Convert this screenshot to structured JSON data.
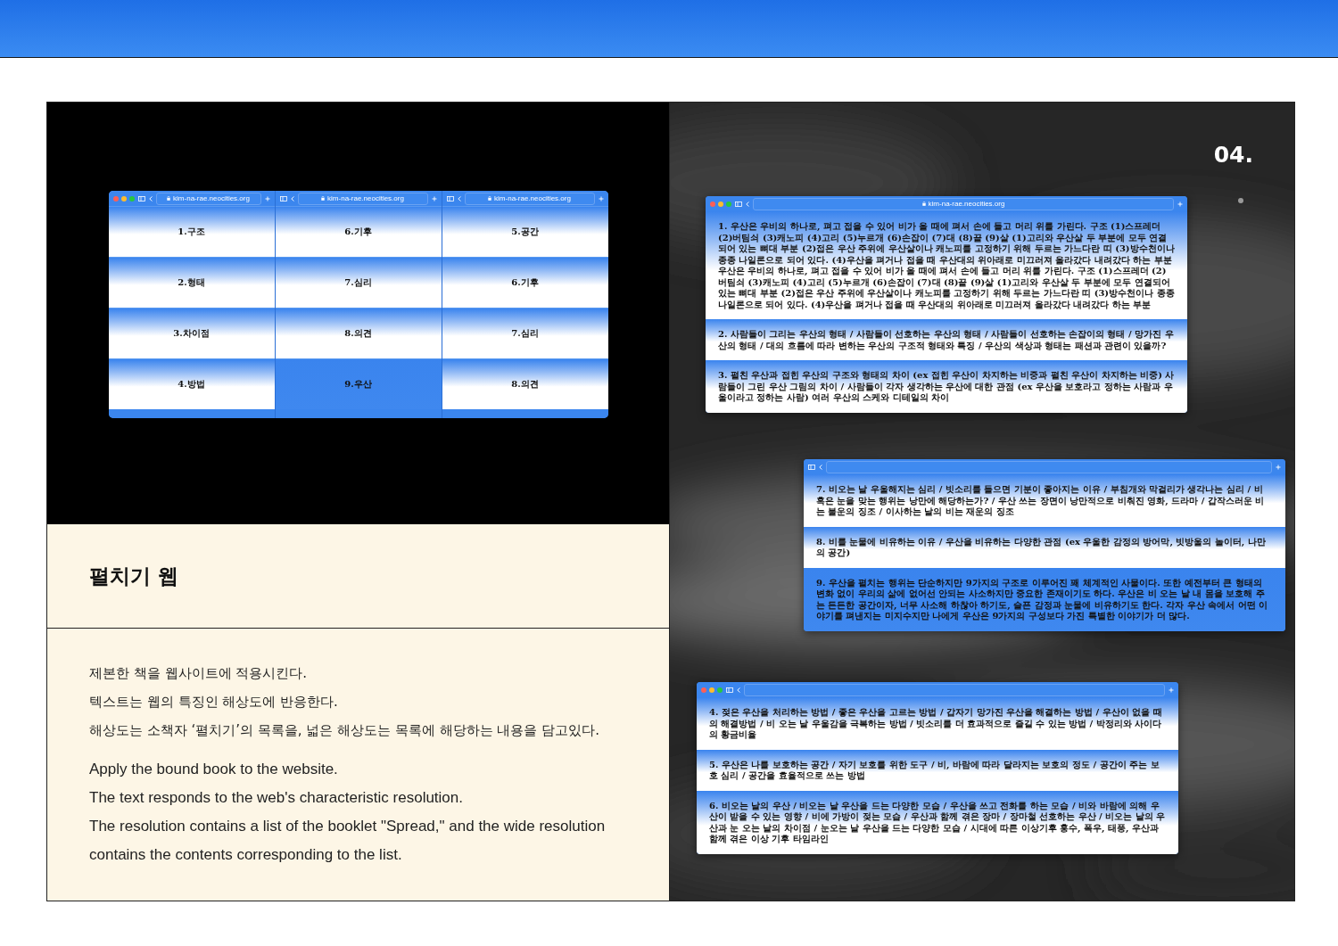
{
  "preview": {
    "windows": [
      {
        "url": "kim-na-rae.neocities.org",
        "traffic_lights": true,
        "items": [
          {
            "label": "1.구조",
            "kind": "fade"
          },
          {
            "label": "2.형태",
            "kind": "fade"
          },
          {
            "label": "3.차이점",
            "kind": "fade"
          },
          {
            "label": "4.방법",
            "kind": "fade"
          }
        ]
      },
      {
        "url": "kim-na-rae.neocities.org",
        "traffic_lights": false,
        "items": [
          {
            "label": "6.기후",
            "kind": "fade"
          },
          {
            "label": "7.심리",
            "kind": "fade"
          },
          {
            "label": "8.의견",
            "kind": "fade"
          },
          {
            "label": "9.우산",
            "kind": "solid"
          }
        ]
      },
      {
        "url": "kim-na-rae.neocities.org",
        "traffic_lights": false,
        "items": [
          {
            "label": "5.공간",
            "kind": "fade"
          },
          {
            "label": "6.기후",
            "kind": "fade"
          },
          {
            "label": "7.심리",
            "kind": "fade"
          },
          {
            "label": "8.의견",
            "kind": "fade"
          }
        ]
      }
    ]
  },
  "project": {
    "title": "펼치기 웹",
    "description_ko": [
      "제본한 책을 웹사이트에 적용시킨다.",
      "텍스트는 웹의 특징인 해상도에 반응한다.",
      "해상도는 소책자 ‘펼치기’의 목록을, 넓은 해상도는 목록에 해당하는 내용을 담고있다."
    ],
    "description_en": [
      "Apply the bound book to the website.",
      "The text responds to the web's characteristic resolution.",
      "The resolution contains a list of the booklet \"Spread,\" and the wide resolution contains the contents corresponding to the list."
    ]
  },
  "showcase": {
    "number": "04.",
    "windows": [
      {
        "url": "kim-na-rae.neocities.org",
        "traffic_lights": true,
        "sections": [
          {
            "kind": "fade",
            "text": "1. 우산은 우비의 하나로, 펴고 접을 수 있어 비가 올 때에 펴서 손에 들고 머리 위를 가린다. 구조 (1)스프레더 (2)버팀쇠 (3)캐노피 (4)고리 (5)누르개 (6)손잡이 (7)대 (8)끝 (9)살 (1)고리와 우산살 두 부분에 모두 연결되어 있는 뼈대 부분 (2)접은 우산 주위에 우산살이나 캐노피를 고정하기 위해 두르는 가느다란 띠 (3)방수천이나 종종 나일론으로 되어 있다. (4)우산을 펴거나 접을 때 우산대의 위아래로 미끄러져 올라갔다 내려갔다 하는 부분 우산은 우비의 하나로, 펴고 접을 수 있어 비가 올 때에 펴서 손에 들고 머리 위를 가린다. 구조 (1)스프레더 (2)버팀쇠 (3)캐노피 (4)고리 (5)누르개 (6)손잡이 (7)대 (8)끝 (9)살 (1)고리와 우산살 두 부분에 모두 연결되어 있는 뼈대 부분 (2)접은 우산 주위에 우산살이나 캐노피를 고정하기 위해 두르는 가느다란 띠 (3)방수천이나 종종 나일론으로 되어 있다. (4)우산을 펴거나 접을 때 우산대의 위아래로 미끄러져 올라갔다 내려갔다 하는 부분"
          },
          {
            "kind": "fade",
            "text": "2. 사람들이 그리는 우산의 형태 / 사람들이 선호하는 우산의 형태 / 사람들이 선호하는 손잡이의 형태 / 망가진 우산의 형태 / 대의 흐름에 따라 변하는 우산의 구조적 형태와 특징 / 우산의 색상과 형태는 패션과 관련이 있을까?"
          },
          {
            "kind": "fade",
            "text": "3. 펼친 우산과 접힌 우산의 구조와 형태의 차이 (ex 접힌 우산이 차지하는 비중과 펼친 우산이 차지하는 비중) 사람들이 그린 우산 그림의 차이 / 사람들이 각자 생각하는 우산에 대한 관점 (ex 우산을 보호라고 정하는 사람과 우울이라고 정하는 사람) 여러 우산의 스케와 디테일의 차이"
          }
        ]
      },
      {
        "traffic_lights": false,
        "sections": [
          {
            "kind": "fade",
            "text": "7. 비오는 날 우울해지는 심리 / 빗소리를 들으면 기분이 좋아지는 이유 / 부침개와 막걸리가 생각나는 심리 / 비 혹은 눈을 맞는 행위는 낭만에 해당하는가? / 우산 쓰는 장면이 낭만적으로 비춰진 영화, 드라마 / 갑작스러운 비는 불운의 징조 / 이사하는 날의 비는 재운의 징조"
          },
          {
            "kind": "fade",
            "text": "8. 비를 눈물에 비유하는 이유 / 우산을 비유하는 다양한 관점 (ex 우울한 감정의 방어막, 빗방울의 놀이터, 나만의 공간)"
          },
          {
            "kind": "solid",
            "text": "9. 우산을 펼치는 행위는 단순하지만 9가지의 구조로 이루어진 꽤 체계적인 사물이다. 또한 예전부터 큰 형태의 변화 없이 우리의 삶에 없어선 안되는 사소하지만 중요한 존재이기도 하다. 우산은 비 오는 날 내 몸을 보호해 주는 든든한 공간이자, 너무 사소해 하찮아 하기도, 슬픈 감정과 눈물에 비유하기도 한다. 각자 우산 속에서 어떤 이야기를 펴낸지는 미지수지만 나에게 우산은 9가지의 구성보다 가진 특별한 이야기가 더 많다."
          }
        ]
      },
      {
        "traffic_lights": true,
        "sections": [
          {
            "kind": "fade",
            "text": "4. 젖은 우산을 처리하는 방법 / 좋은 우산을 고르는 방법 / 갑자기 망가진 우산을 해결하는 방법 / 우산이 없을 때의 해결방법 / 비 오는 날 우울감을 극복하는 방법 / 빗소리를 더 효과적으로 즐길 수 있는 방법 / 박정리와 사이다의 황금비율"
          },
          {
            "kind": "fade",
            "text": "5. 우산은 나를 보호하는 공간 / 자기 보호를 위한 도구 / 비, 바람에 따라 달라지는 보호의 정도 / 공간이 주는 보호 심리 / 공간을 효율적으로 쓰는 방법"
          },
          {
            "kind": "fade",
            "text": "6. 비오는 날의 우산 / 비오는 날 우산을 드는 다양한 모습 / 우산을 쓰고 전화를 하는 모습 / 비와 바람에 의해 우산이 받을 수 있는 영향 / 비에 가방이 젖는 모습 / 우산과 함께 겪은 장마 / 장마철 선호하는 우산 / 비오는 날의 우산과 눈 오는 날의 차이점 / 눈오는 날 우산을 드는 다양한 모습 / 시대에 따른 이상기후 홍수, 폭우, 태풍, 우산과 함께 겪은 이상 기후 타임라인"
          }
        ]
      }
    ]
  }
}
